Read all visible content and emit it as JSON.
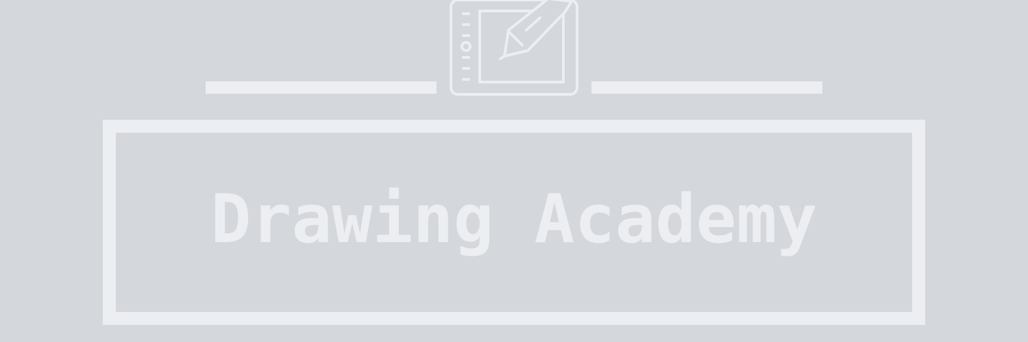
{
  "logo": {
    "icon": "drawing-tablet-icon",
    "name": "Drawing Academy"
  },
  "colors": {
    "background": "#d4d7db",
    "foreground": "#eceef1"
  }
}
